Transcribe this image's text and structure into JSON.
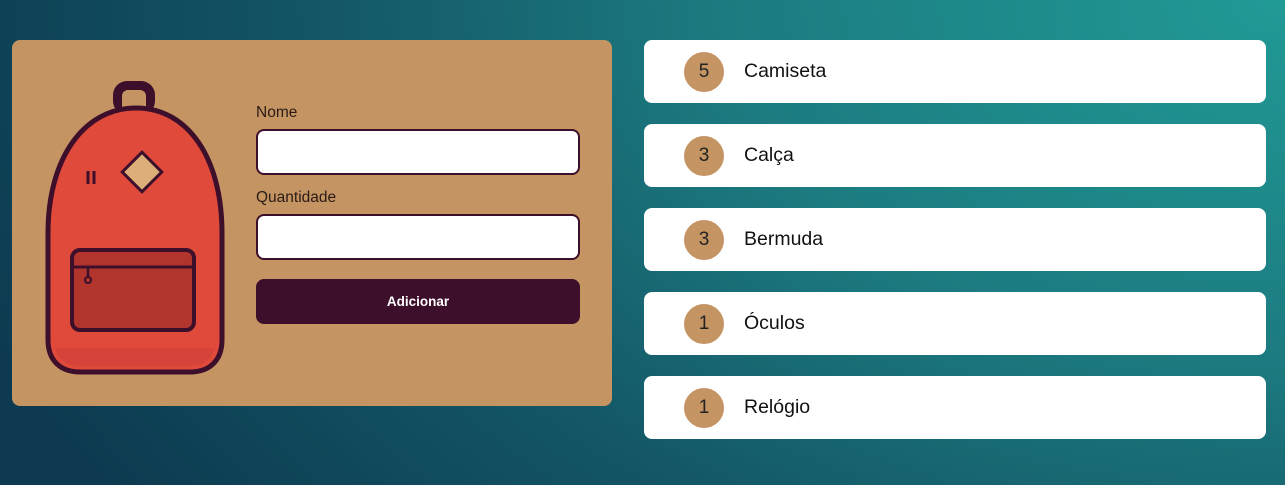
{
  "form": {
    "name_label": "Nome",
    "name_value": "",
    "quantity_label": "Quantidade",
    "quantity_value": "",
    "submit_label": "Adicionar"
  },
  "items": [
    {
      "quantity": "5",
      "name": "Camiseta"
    },
    {
      "quantity": "3",
      "name": "Calça"
    },
    {
      "quantity": "3",
      "name": "Bermuda"
    },
    {
      "quantity": "1",
      "name": "Óculos"
    },
    {
      "quantity": "1",
      "name": "Relógio"
    }
  ],
  "colors": {
    "card": "#c49563",
    "dark": "#3d0f2b",
    "backpack": "#e04a3a",
    "pocket": "#b1342d",
    "badge": "#c49563"
  },
  "icons": {
    "illustration": "backpack-icon"
  }
}
